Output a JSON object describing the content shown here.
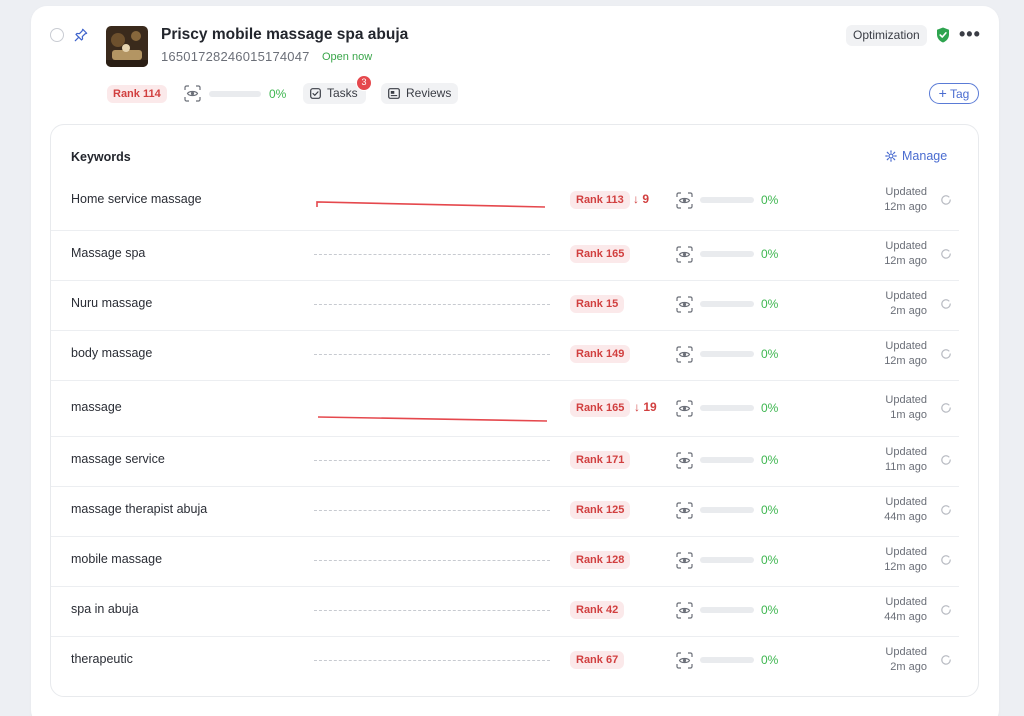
{
  "business": {
    "name": "Priscy mobile massage spa abuja",
    "id": "16501728246015174047",
    "status": "Open now",
    "rank": "Rank 114",
    "progress": "0%",
    "progress_value": 0,
    "optimization_label": "Optimization",
    "tasks_label": "Tasks",
    "tasks_count": "3",
    "reviews_label": "Reviews",
    "tag_label": "Tag"
  },
  "keywords": {
    "title": "Keywords",
    "manage_label": "Manage",
    "rows": [
      {
        "name": "Home service massage",
        "rank": "Rank 113",
        "delta": "9",
        "progress": "0%",
        "updated": [
          "Updated",
          "12m ago"
        ],
        "trend": true
      },
      {
        "name": "Massage spa",
        "rank": "Rank 165",
        "delta": "",
        "progress": "0%",
        "updated": [
          "Updated",
          "12m ago"
        ],
        "trend": false
      },
      {
        "name": "Nuru massage",
        "rank": "Rank 15",
        "delta": "",
        "progress": "0%",
        "updated": [
          "Updated",
          "2m ago"
        ],
        "trend": false
      },
      {
        "name": "body massage",
        "rank": "Rank 149",
        "delta": "",
        "progress": "0%",
        "updated": [
          "Updated",
          "12m ago"
        ],
        "trend": false
      },
      {
        "name": "massage",
        "rank": "Rank 165",
        "delta": "19",
        "progress": "0%",
        "updated": [
          "Updated",
          "1m ago"
        ],
        "trend": true
      },
      {
        "name": "massage service",
        "rank": "Rank 171",
        "delta": "",
        "progress": "0%",
        "updated": [
          "Updated",
          "11m ago"
        ],
        "trend": false
      },
      {
        "name": "massage therapist abuja",
        "rank": "Rank 125",
        "delta": "",
        "progress": "0%",
        "updated": [
          "Updated",
          "44m ago"
        ],
        "trend": false
      },
      {
        "name": "mobile massage",
        "rank": "Rank 128",
        "delta": "",
        "progress": "0%",
        "updated": [
          "Updated",
          "12m ago"
        ],
        "trend": false
      },
      {
        "name": "spa in abuja",
        "rank": "Rank 42",
        "delta": "",
        "progress": "0%",
        "updated": [
          "Updated",
          "44m ago"
        ],
        "trend": false
      },
      {
        "name": "therapeutic",
        "rank": "Rank 67",
        "delta": "",
        "progress": "0%",
        "updated": [
          "Updated",
          "2m ago"
        ],
        "trend": false
      }
    ]
  },
  "colors": {
    "accent": "#4a6cd0",
    "rank_red": "#d13f3f",
    "success_green": "#3eb650"
  }
}
